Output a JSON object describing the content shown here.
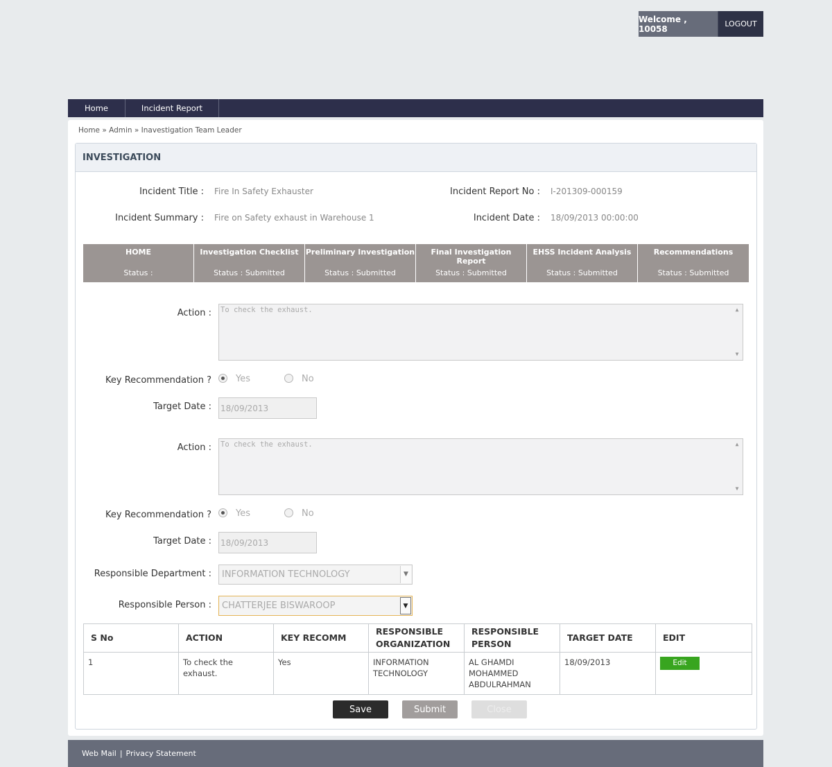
{
  "header": {
    "welcome": "Welcome , 10058",
    "logout": "LOGOUT"
  },
  "nav": {
    "items": [
      {
        "label": "Home"
      },
      {
        "label": "Incident Report"
      }
    ]
  },
  "breadcrumb": "Home » Admin » Inavestigation Team Leader",
  "panel": {
    "title": "INVESTIGATION"
  },
  "incident": {
    "title_label": "Incident Title :",
    "title_value": "Fire In Safety Exhauster",
    "report_no_label": "Incident Report No :",
    "report_no_value": "I-201309-000159",
    "summary_label": "Incident Summary :",
    "summary_value": "Fire on Safety exhaust in Warehouse 1",
    "date_label": "Incident Date :",
    "date_value": "18/09/2013 00:00:00"
  },
  "tabs": [
    {
      "name": "HOME",
      "status": "Status :"
    },
    {
      "name": "Investigation Checklist",
      "status": "Status : Submitted"
    },
    {
      "name": "Preliminary Investigation",
      "status": "Status : Submitted"
    },
    {
      "name": "Final Investigation Report",
      "status": "Status : Submitted"
    },
    {
      "name": "EHSS Incident Analysis",
      "status": "Status : Submitted"
    },
    {
      "name": "Recommendations",
      "status": "Status : Submitted"
    }
  ],
  "form": {
    "action_label": "Action :",
    "key_recommendation_label": "Key Recommendation ?",
    "yes_label": "Yes",
    "no_label": "No",
    "target_date_label": "Target Date :",
    "recommendations": [
      {
        "action": "To check the exhaust.",
        "key": "Yes",
        "target_date": "18/09/2013"
      },
      {
        "action": "To check the exhaust.",
        "key": "Yes",
        "target_date": "18/09/2013"
      }
    ],
    "department_label": "Responsible Department :",
    "department_value": "INFORMATION TECHNOLOGY",
    "person_label": "Responsible Person :",
    "person_value": "CHATTERJEE BISWAROOP"
  },
  "table": {
    "headers": [
      "S No",
      "ACTION",
      "KEY RECOMM",
      "RESPONSIBLE ORGANIZATION",
      "RESPONSIBLE PERSON",
      "TARGET DATE",
      "EDIT"
    ],
    "rows": [
      {
        "sno": "1",
        "action": "To check the exhaust.",
        "key": "Yes",
        "organization": "INFORMATION TECHNOLOGY",
        "person": "AL GHAMDI MOHAMMED ABDULRAHMAN",
        "target_date": "18/09/2013",
        "edit_label": "Edit"
      }
    ]
  },
  "buttons": {
    "save": "Save",
    "submit": "Submit",
    "close": "Close"
  },
  "footer": {
    "webmail": "Web Mail",
    "separator": "|",
    "privacy": "Privacy Statement"
  },
  "colors": {
    "nav_bg": "#2d2f4b",
    "tab_bg": "#9b9593",
    "footer_bg": "#676c7a",
    "edit_button": "#38a51f"
  }
}
